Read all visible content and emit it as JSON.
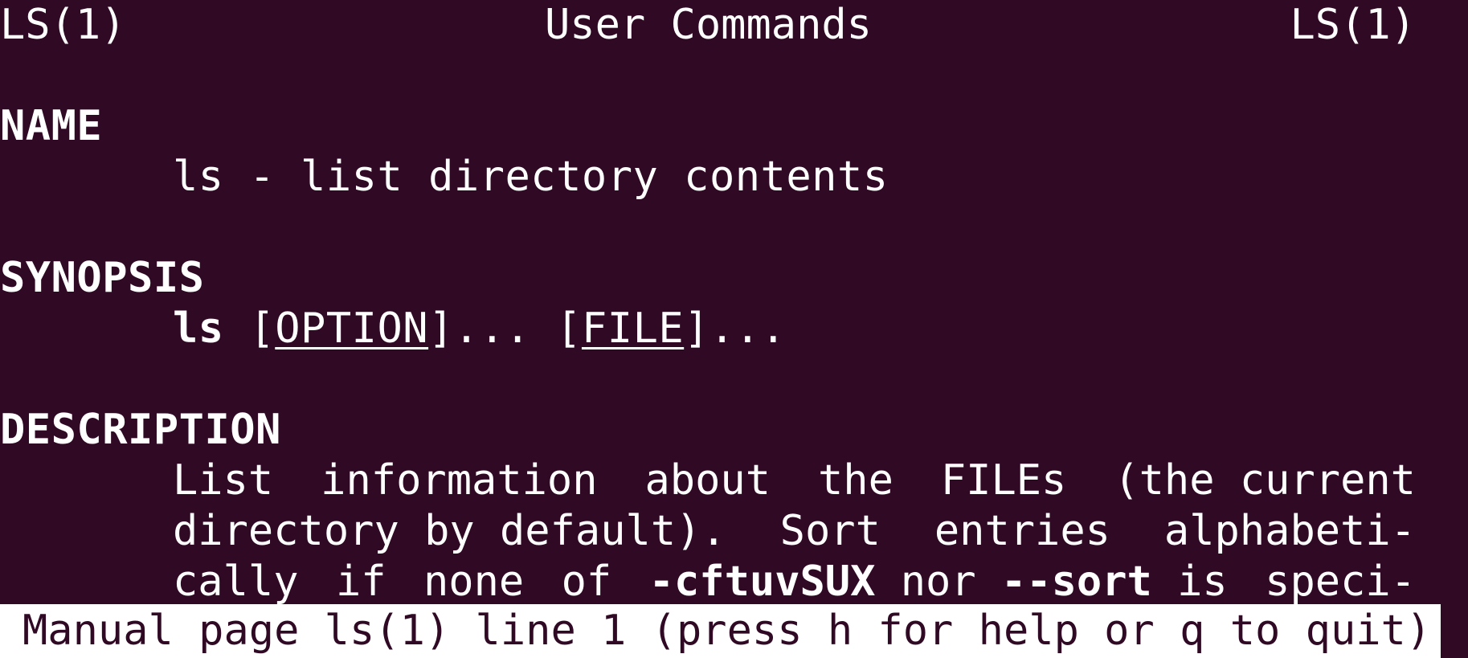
{
  "header": {
    "left": "LS(1)",
    "center": "User Commands",
    "right": "LS(1)"
  },
  "name_section": {
    "heading": "NAME",
    "text": "ls - list directory contents"
  },
  "synopsis": {
    "heading": "SYNOPSIS",
    "command": "ls",
    "open1": "[",
    "arg1": "OPTION",
    "close1": "]...",
    "sep": " ",
    "open2": "[",
    "arg2": "FILE",
    "close2": "]..."
  },
  "description": {
    "heading": "DESCRIPTION",
    "line1_words": [
      "List",
      "information",
      "about",
      "the",
      "FILEs",
      "(the current"
    ],
    "line2_words": [
      "directory by default).",
      "Sort",
      "entries",
      "alphabeti-"
    ],
    "line3": {
      "w1": "cally",
      "w2": "if",
      "w3": "none",
      "w4": "of",
      "opt1": "-cftuvSUX",
      "w5": "nor",
      "opt2": "--sort",
      "w6": "is",
      "w7": "speci-"
    }
  },
  "status_bar": {
    "text": "Manual page ls(1) line 1 (press h for help or q to quit)"
  },
  "colors": {
    "background": "#300a24",
    "foreground": "#ffffff"
  }
}
